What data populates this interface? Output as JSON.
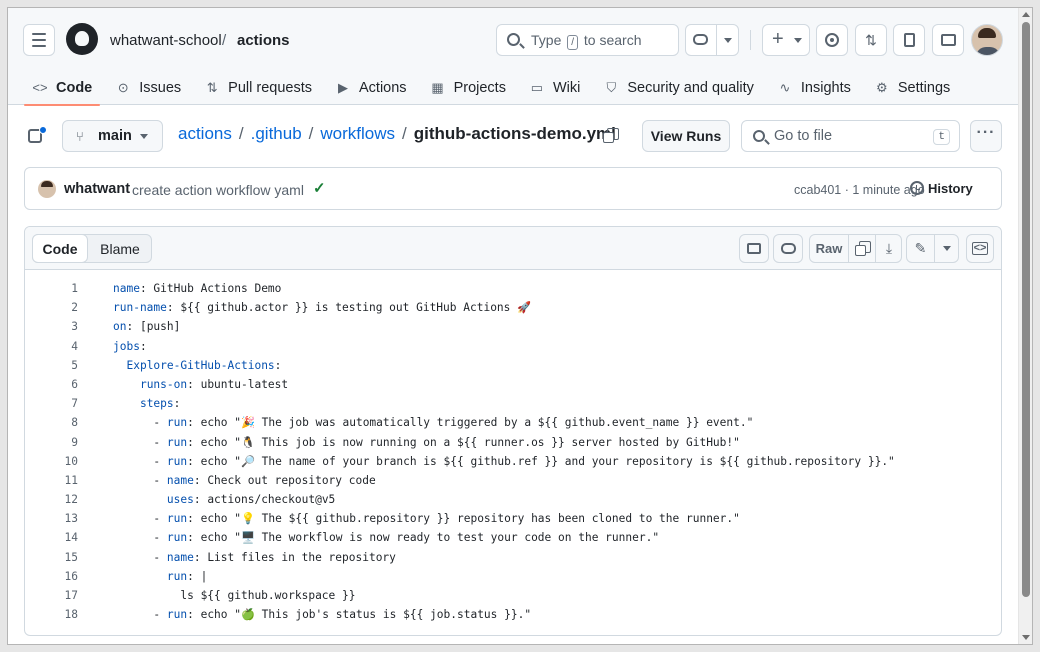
{
  "header": {
    "owner": "whatwant-school",
    "separator": "/",
    "repo": "actions",
    "search_pre": "Type",
    "search_key": "/",
    "search_post": "to search"
  },
  "nav": {
    "tabs": [
      {
        "label": "Code",
        "icon": "<>"
      },
      {
        "label": "Issues",
        "icon": "⊙"
      },
      {
        "label": "Pull requests",
        "icon": "⇅"
      },
      {
        "label": "Actions",
        "icon": "▶"
      },
      {
        "label": "Projects",
        "icon": "▦"
      },
      {
        "label": "Wiki",
        "icon": "▭"
      },
      {
        "label": "Security and quality",
        "icon": "⛉"
      },
      {
        "label": "Insights",
        "icon": "∿"
      },
      {
        "label": "Settings",
        "icon": "⚙"
      }
    ]
  },
  "file_bar": {
    "branch": "main",
    "crumbs": [
      "actions",
      ".github",
      "workflows"
    ],
    "filename": "github-actions-demo.yml",
    "view_runs": "View Runs",
    "goto_placeholder": "Go to file",
    "goto_key": "t",
    "more": "···"
  },
  "commit": {
    "user": "whatwant",
    "message": "create action workflow yaml",
    "check": "✓",
    "meta": "ccab401 · 1 minute ago",
    "history": "History"
  },
  "code_view": {
    "tab_code": "Code",
    "tab_blame": "Blame",
    "raw": "Raw",
    "lines": [
      {
        "n": "1",
        "key": "name",
        "rest": ": GitHub Actions Demo",
        "indent": ""
      },
      {
        "n": "2",
        "key": "run-name",
        "rest": ": ${{ github.actor }} is testing out GitHub Actions 🚀",
        "indent": ""
      },
      {
        "n": "3",
        "key": "on",
        "rest": ": [push]",
        "indent": ""
      },
      {
        "n": "4",
        "key": "jobs",
        "rest": ":",
        "indent": ""
      },
      {
        "n": "5",
        "key": "Explore-GitHub-Actions",
        "rest": ":",
        "indent": "  "
      },
      {
        "n": "6",
        "key": "runs-on",
        "rest": ": ubuntu-latest",
        "indent": "    "
      },
      {
        "n": "7",
        "key": "steps",
        "rest": ":",
        "indent": "    "
      },
      {
        "n": "8",
        "key": "run",
        "rest": ": echo \"🎉 The job was automatically triggered by a ${{ github.event_name }} event.\"",
        "indent": "      - "
      },
      {
        "n": "9",
        "key": "run",
        "rest": ": echo \"🐧 This job is now running on a ${{ runner.os }} server hosted by GitHub!\"",
        "indent": "      - "
      },
      {
        "n": "10",
        "key": "run",
        "rest": ": echo \"🔎 The name of your branch is ${{ github.ref }} and your repository is ${{ github.repository }}.\"",
        "indent": "      - "
      },
      {
        "n": "11",
        "key": "name",
        "rest": ": Check out repository code",
        "indent": "      - "
      },
      {
        "n": "12",
        "key": "uses",
        "rest": ": actions/checkout@v5",
        "indent": "        "
      },
      {
        "n": "13",
        "key": "run",
        "rest": ": echo \"💡 The ${{ github.repository }} repository has been cloned to the runner.\"",
        "indent": "      - "
      },
      {
        "n": "14",
        "key": "run",
        "rest": ": echo \"🖥️ The workflow is now ready to test your code on the runner.\"",
        "indent": "      - "
      },
      {
        "n": "15",
        "key": "name",
        "rest": ": List files in the repository",
        "indent": "      - "
      },
      {
        "n": "16",
        "key": "run",
        "rest": ": |",
        "indent": "        "
      },
      {
        "n": "17",
        "key": "",
        "rest": "ls ${{ github.workspace }}",
        "indent": "          "
      },
      {
        "n": "18",
        "key": "run",
        "rest": ": echo \"🍏 This job's status is ${{ job.status }}.\"",
        "indent": "      - "
      }
    ]
  }
}
